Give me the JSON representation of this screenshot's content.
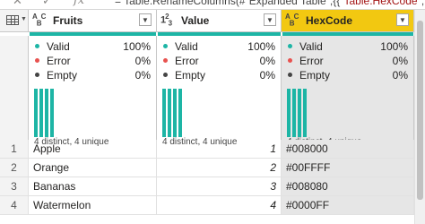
{
  "formula_bar": {
    "fx_label": "fx",
    "formula_prefix": "= Table.RenameColumns(#\"Expanded Table\",{{",
    "formula_string": "\"Table.HexCode\"",
    "formula_suffix": ","
  },
  "columns": [
    {
      "title": "Fruits",
      "type_icon": "ABC",
      "valid": "100%",
      "error": "0%",
      "empty": "0%",
      "distribution": "4 distinct, 4 unique"
    },
    {
      "title": "Value",
      "type_icon": "123",
      "valid": "100%",
      "error": "0%",
      "empty": "0%",
      "distribution": "4 distinct, 4 unique"
    },
    {
      "title": "HexCode",
      "type_icon": "ABC",
      "valid": "100%",
      "error": "0%",
      "empty": "0%",
      "distribution": "4 distinct, 4 unique"
    }
  ],
  "stat_labels": {
    "valid": "Valid",
    "error": "Error",
    "empty": "Empty"
  },
  "colors": {
    "valid": "#1db5a5",
    "error": "#e8524f",
    "empty": "#444444",
    "selected_header": "#f2c811"
  },
  "rows": [
    {
      "num": "1",
      "fruits": "Apple",
      "value": "1",
      "hex": "#008000"
    },
    {
      "num": "2",
      "fruits": "Orange",
      "value": "2",
      "hex": "#00FFFF"
    },
    {
      "num": "3",
      "fruits": "Bananas",
      "value": "3",
      "hex": "#008080"
    },
    {
      "num": "4",
      "fruits": "Watermelon",
      "value": "4",
      "hex": "#0000FF"
    }
  ]
}
